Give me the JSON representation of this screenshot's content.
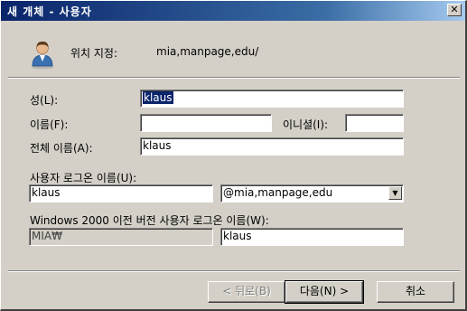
{
  "window": {
    "title": "새 개체 - 사용자",
    "close_glyph": "✕"
  },
  "location": {
    "label": "위치 지정:",
    "value": "mia,manpage,edu/"
  },
  "form": {
    "last_name_label": "성(L):",
    "last_name_value": "klaus",
    "first_name_label": "이름(F):",
    "first_name_value": "",
    "initials_label": "이니셜(I):",
    "initials_value": "",
    "full_name_label": "전체 이름(A):",
    "full_name_value": "klaus",
    "logon_name_label": "사용자 로그온 이름(U):",
    "logon_name_value": "klaus",
    "upn_suffix_value": "@mia,manpage,edu",
    "pre2000_label": "Windows 2000 이전 버전 사용자 로그온 이름(W):",
    "pre2000_domain_value": "MIA₩",
    "pre2000_name_value": "klaus"
  },
  "buttons": {
    "back": "< 뒤로(B)",
    "next": "다음(N) >",
    "cancel": "취소"
  },
  "icons": {
    "user": "user-icon",
    "close": "close-icon",
    "dropdown": "chevron-down-icon"
  }
}
